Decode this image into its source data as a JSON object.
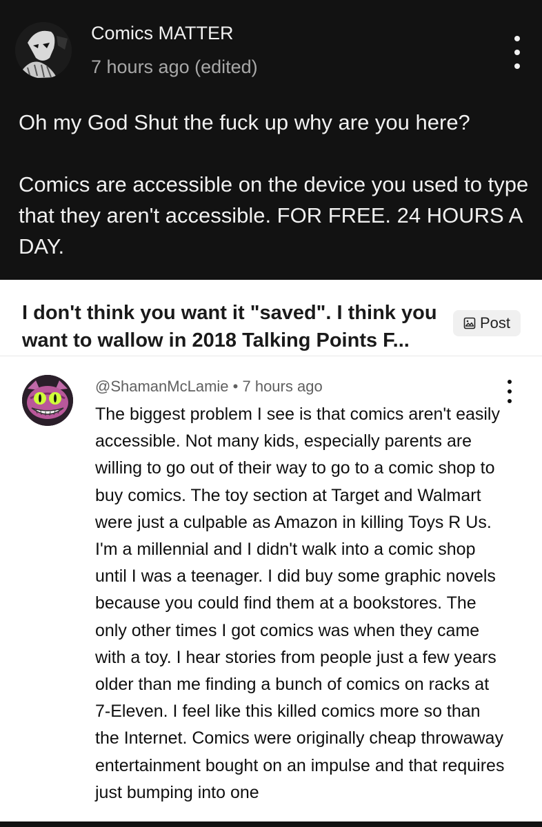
{
  "reply": {
    "author": "Comics MATTER",
    "time": "7 hours ago (edited)",
    "paragraph1": "Oh my God Shut the fuck up why are you here?",
    "paragraph2": "Comics are accessible on the device you used to type that they aren't accessible. FOR FREE. 24 HOURS A DAY."
  },
  "card": {
    "title": "I don't think you want it \"saved\". I think you want to wallow in 2018 Talking Points F...",
    "post_label": "Post"
  },
  "comment": {
    "handle": "@ShamanMcLamie",
    "separator": "•",
    "time": "7 hours ago",
    "text": "The biggest problem I see is that comics aren't easily accessible. Not many kids, especially parents are willing to go out of their way to go to a comic shop to buy comics. The toy section at Target and Walmart were just a culpable as Amazon in killing Toys R Us. I'm a millennial and I didn't walk into a comic shop until I was a teenager. I did buy some graphic novels because you could find them at a bookstores. The only other times I got comics was when they came with a toy. I hear stories from people just a few years older than me finding a bunch of comics on racks at 7-Eleven. I feel like this killed comics more so than the Internet. Comics were originally cheap throwaway entertainment bought on an impulse and that requires just bumping into one"
  },
  "colors": {
    "dark_bg": "#121212",
    "light_bg": "#ffffff",
    "muted": "#606060"
  },
  "icons": [
    "avatar-dark",
    "more-vert-icon",
    "post-image-icon",
    "cheshire-avatar"
  ]
}
